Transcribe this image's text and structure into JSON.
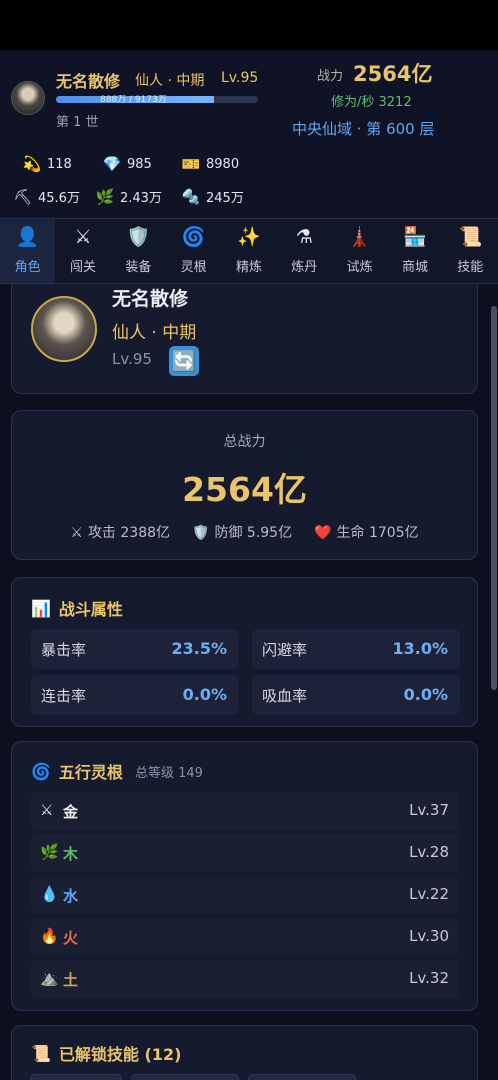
{
  "header": {
    "name": "无名散修",
    "realm": "仙人 · 中期",
    "level": "Lv.95",
    "exp_text": "888万 / 9173万",
    "exp_progress": 0.78,
    "generation": "第 1 世",
    "power_label": "战力",
    "power_value": "2564亿",
    "rate": "修为/秒 3212",
    "location": "中央仙域 · 第 600 层"
  },
  "resources": [
    {
      "icon": "star-fragment-icon",
      "glyph": "💫",
      "value": "118"
    },
    {
      "icon": "diamond-icon",
      "glyph": "💎",
      "value": "985"
    },
    {
      "icon": "ticket-icon",
      "glyph": "🎫",
      "value": "8980"
    },
    {
      "icon": "pickaxe-icon",
      "glyph": "⛏",
      "value": "45.6万"
    },
    {
      "icon": "herb-icon",
      "glyph": "🌿",
      "value": "2.43万"
    },
    {
      "icon": "ore-icon",
      "glyph": "🔩",
      "value": "245万"
    }
  ],
  "tabs": [
    {
      "label": "角色",
      "icon": "character-icon",
      "glyph": "👤",
      "active": true
    },
    {
      "label": "闯关",
      "icon": "crossed-swords-icon",
      "glyph": "⚔",
      "active": false
    },
    {
      "label": "装备",
      "icon": "shield-icon",
      "glyph": "🛡️",
      "active": false
    },
    {
      "label": "灵根",
      "icon": "swirl-icon",
      "glyph": "🌀",
      "active": false
    },
    {
      "label": "精炼",
      "icon": "sparkles-icon",
      "glyph": "✨",
      "active": false
    },
    {
      "label": "炼丹",
      "icon": "flask-icon",
      "glyph": "⚗",
      "active": false
    },
    {
      "label": "试炼",
      "icon": "tower-icon",
      "glyph": "🗼",
      "active": false
    },
    {
      "label": "商城",
      "icon": "shop-icon",
      "glyph": "🏪",
      "active": false
    },
    {
      "label": "技能",
      "icon": "scroll-icon",
      "glyph": "📜",
      "active": false
    }
  ],
  "profile": {
    "name": "无名散修",
    "realm": "仙人 · 中期",
    "level": "Lv.95",
    "swap_glyph": "🔄"
  },
  "power": {
    "label": "总战力",
    "value": "2564亿",
    "attack_glyph": "⚔",
    "attack": "攻击 2388亿",
    "defense_glyph": "🛡️",
    "defense": "防御 5.95亿",
    "hp_glyph": "❤️",
    "hp": "生命 1705亿"
  },
  "battle": {
    "title_glyph": "📊",
    "title": "战斗属性",
    "attrs": [
      {
        "name": "暴击率",
        "value": "23.5%"
      },
      {
        "name": "闪避率",
        "value": "13.0%"
      },
      {
        "name": "连击率",
        "value": "0.0%"
      },
      {
        "name": "吸血率",
        "value": "0.0%"
      }
    ]
  },
  "roots": {
    "title_glyph": "🌀",
    "title": "五行灵根",
    "subtitle": "总等级 149",
    "items": [
      {
        "glyph": "⚔",
        "name": "金",
        "level": "Lv.37",
        "color": "#f0f0f0"
      },
      {
        "glyph": "🌿",
        "name": "木",
        "level": "Lv.28",
        "color": "#5fbf6f"
      },
      {
        "glyph": "💧",
        "name": "水",
        "level": "Lv.22",
        "color": "#5ea6f2"
      },
      {
        "glyph": "🔥",
        "name": "火",
        "level": "Lv.30",
        "color": "#f06a4a"
      },
      {
        "glyph": "⛰️",
        "name": "土",
        "level": "Lv.32",
        "color": "#c9a86a"
      }
    ]
  },
  "skills": {
    "title_glyph": "📜",
    "title": "已解锁技能 (12)"
  }
}
